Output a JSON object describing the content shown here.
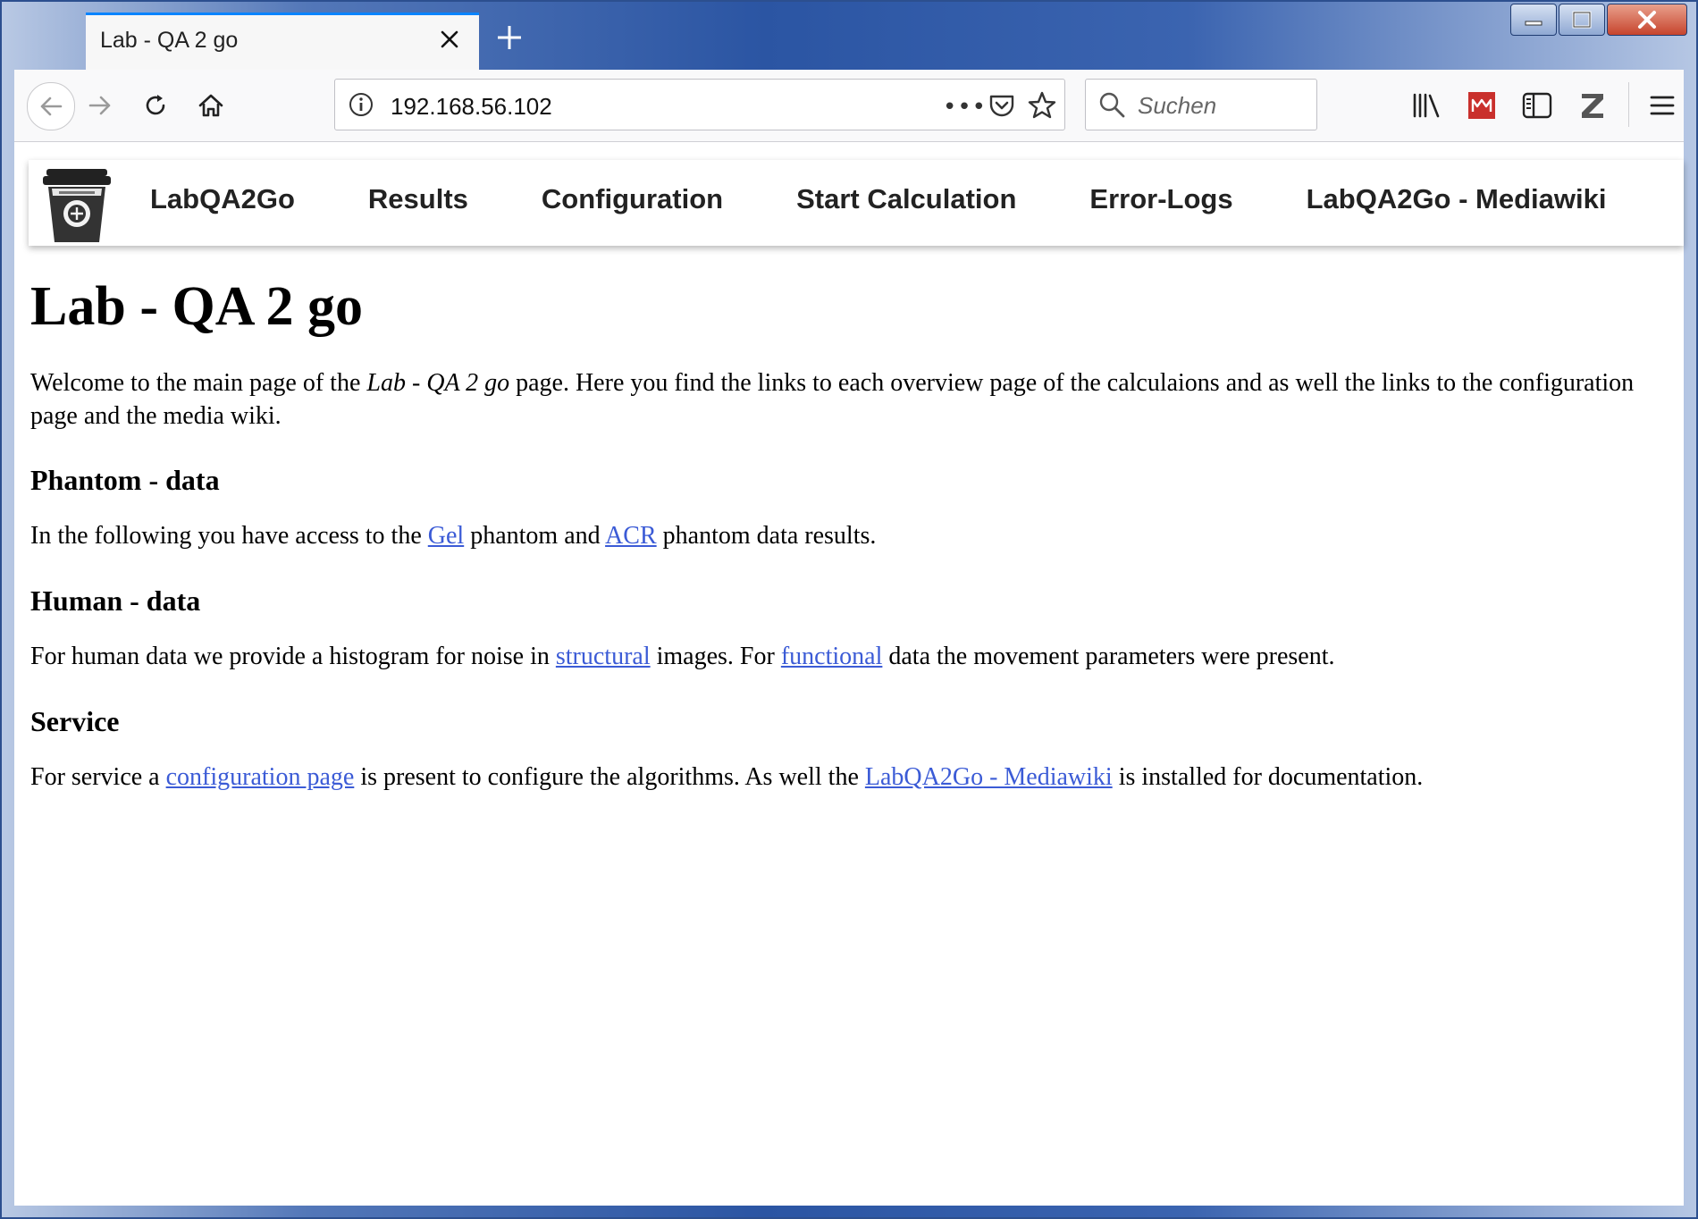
{
  "browser": {
    "tab_title": "Lab - QA 2 go",
    "url": "192.168.56.102",
    "search_placeholder": "Suchen",
    "toolbar_icons": [
      "library-icon",
      "zotero-red-icon",
      "sidebar-icon",
      "zotero-z-icon",
      "hamburger-menu-icon"
    ],
    "accent_color": "#0a84ff"
  },
  "site_nav": {
    "items": [
      "LabQA2Go",
      "Results",
      "Configuration",
      "Start Calculation",
      "Error-Logs",
      "LabQA2Go - Mediawiki"
    ]
  },
  "page": {
    "title": "Lab - QA 2 go",
    "intro": {
      "before": "Welcome to the main page of the ",
      "emph": "Lab - QA 2 go",
      "after": " page. Here you find the links to each overview page of the calculaions and as well the links to the configuration page and the media wiki."
    },
    "phantom": {
      "heading": "Phantom - data",
      "t1": "In the following you have access to the ",
      "link_gel": "Gel",
      "t2": " phantom and ",
      "link_acr": "ACR",
      "t3": " phantom data results."
    },
    "human": {
      "heading": "Human - data",
      "t1": "For human data we provide a histogram for noise in ",
      "link_structural": "structural",
      "t2": " images. For ",
      "link_functional": "functional",
      "t3": " data the movement parameters were present."
    },
    "service": {
      "heading": "Service",
      "t1": "For service a ",
      "link_config": "configuration page",
      "t2": " is present to configure the algorithms. As well the ",
      "link_wiki": "LabQA2Go - Mediawiki",
      "t3": " is installed for documentation."
    },
    "link_color": "#3b5bd6"
  }
}
